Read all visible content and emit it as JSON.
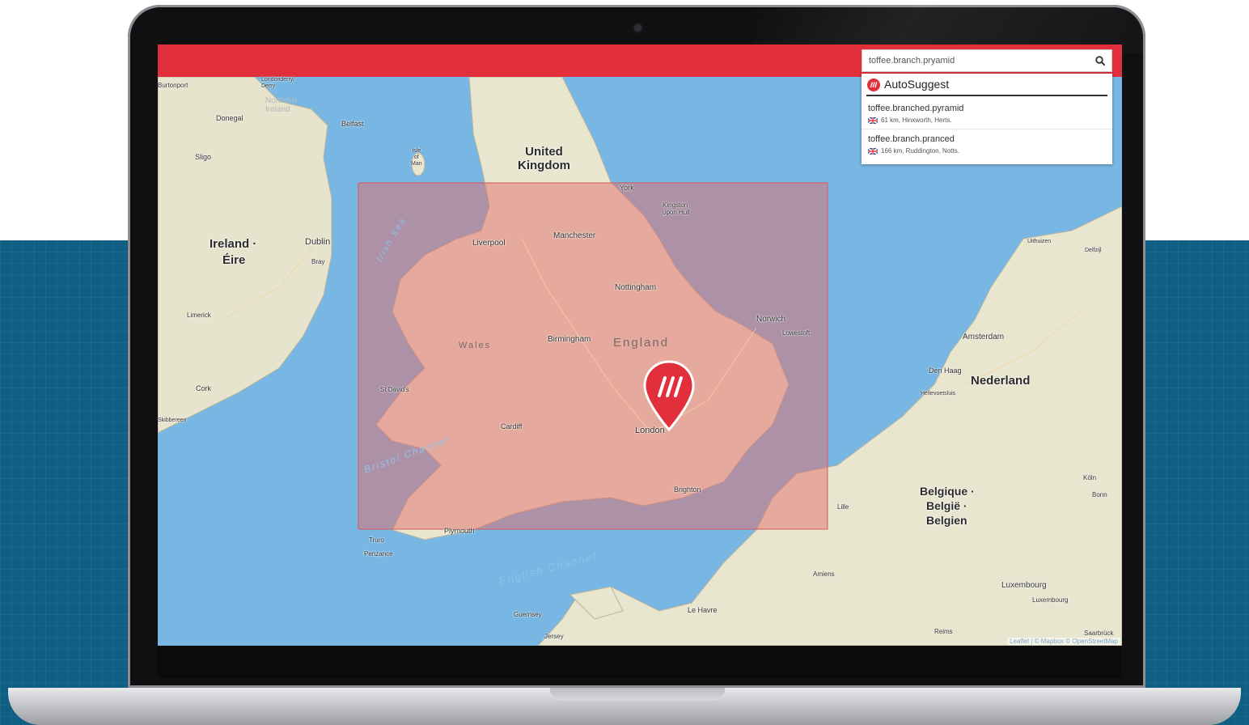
{
  "search": {
    "value": "toffee.branch.pryamid",
    "icon": "search-icon"
  },
  "autosuggest": {
    "title": "AutoSuggest",
    "items": [
      {
        "words": "toffee.branched.pyramid",
        "meta": "61 km, Hinxworth, Herts."
      },
      {
        "words": "toffee.branch.pranced",
        "meta": "166 km, Ruddington, Notts."
      }
    ]
  },
  "map": {
    "labels": {
      "united_kingdom": "United\nKingdom",
      "ireland": "Ireland ·",
      "eire": "Éire",
      "england": "England",
      "wales": "Wales",
      "nederland": "Nederland",
      "belgique": "Belgique ·",
      "belgie": "België ·",
      "belgien": "Belgien",
      "london": "London",
      "manchester": "Manchester",
      "liverpool": "Liverpool",
      "birmingham": "Birmingham",
      "nottingham": "Nottingham",
      "norwich": "Norwich",
      "lowestoft": "Lowestoft",
      "york": "York",
      "kingston": "Kingston\nupon Hull",
      "cardiff": "Cardiff",
      "st_davids": "St David's",
      "plymouth": "Plymouth",
      "truro": "Truro",
      "penzance": "Penzance",
      "brighton": "Brighton",
      "dublin": "Dublin",
      "bray": "Bray",
      "belfast": "Belfast",
      "donegal": "Donegal",
      "sligo": "Sligo",
      "limerick": "Limerick",
      "cork": "Cork",
      "burtonport": "Burtonport",
      "londonderry": "Londonderry/\nDerry",
      "northern_ireland": "Northern\nIreland",
      "isle_of_man": "Isle\nof\nMan",
      "amsterdam": "Amsterdam",
      "den_haag": "Den Haag",
      "hellevoetsluis": "Hellevoetsluis",
      "uithuizen": "Uithuizen",
      "delfzijl": "Delfzijl",
      "lille": "Lille",
      "amiens": "Amiens",
      "le_havre": "Le Havre",
      "guernsey": "Guernsey",
      "jersey": "Jersey",
      "reims": "Reims",
      "luxembourg": "Luxembourg",
      "luxembourg_city": "Luxembourg",
      "koln": "Köln",
      "bonn": "Bonn",
      "saarbrucken": "Saarbrück",
      "skibbereen": "Skibbereen",
      "irish_sea": "Irish Sea",
      "bristol_channel": "Bristol Channel",
      "english_channel": "English Channel"
    },
    "attribution": "Leaflet | © Mapbox © OpenStreetMap",
    "colors": {
      "sea": "#78b7e3",
      "land": "#eae7d3",
      "overlay": "#e26b6b",
      "topbar": "#e1303c",
      "pin": "#e1303c"
    }
  }
}
